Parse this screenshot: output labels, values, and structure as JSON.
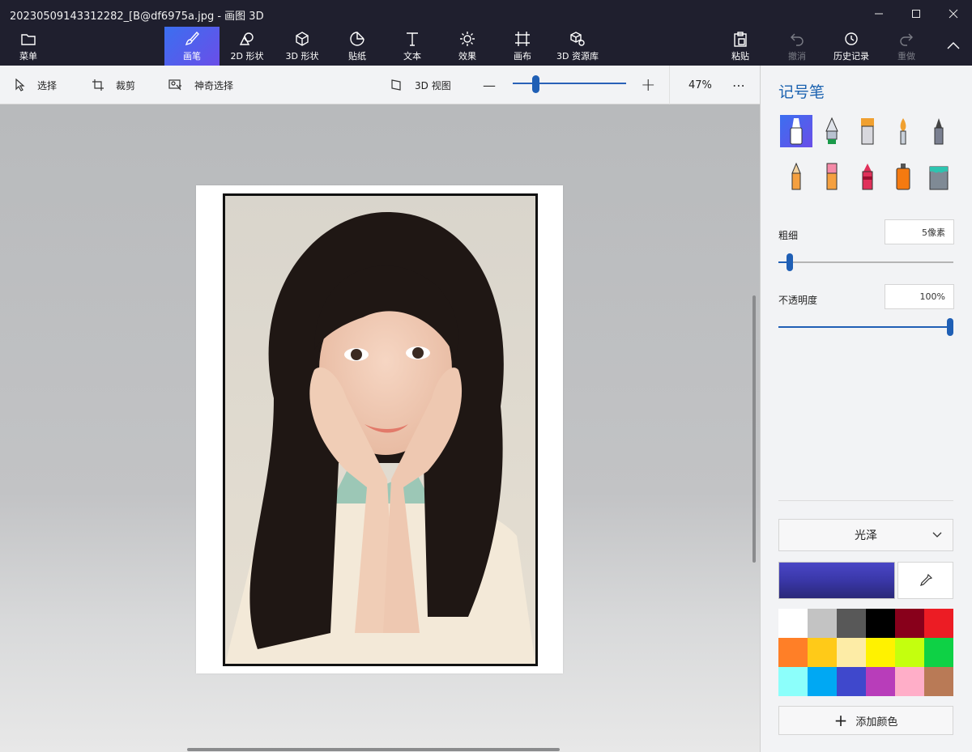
{
  "window": {
    "title": "20230509143312282_[B@df6975a.jpg - 画图 3D"
  },
  "ribbon": {
    "menu": "菜单",
    "tools": [
      {
        "label": "画笔",
        "icon": "brush-icon",
        "active": true
      },
      {
        "label": "2D 形状",
        "icon": "2d-shapes-icon"
      },
      {
        "label": "3D 形状",
        "icon": "3d-shapes-icon"
      },
      {
        "label": "贴纸",
        "icon": "sticker-icon"
      },
      {
        "label": "文本",
        "icon": "text-icon"
      },
      {
        "label": "效果",
        "icon": "effects-icon"
      },
      {
        "label": "画布",
        "icon": "canvas-icon"
      },
      {
        "label": "3D 资源库",
        "icon": "3d-library-icon"
      }
    ],
    "right": [
      {
        "label": "粘贴",
        "icon": "paste-icon",
        "enabled": true
      },
      {
        "label": "撤消",
        "icon": "undo-icon",
        "enabled": false
      },
      {
        "label": "历史记录",
        "icon": "history-icon",
        "enabled": true
      },
      {
        "label": "重做",
        "icon": "redo-icon",
        "enabled": false
      }
    ]
  },
  "toolbar": {
    "select": "选择",
    "crop": "裁剪",
    "magic_select": "神奇选择",
    "view3d": "3D 视图",
    "zoom_minus": "—",
    "zoom_plus": "+",
    "zoom": "47%",
    "zoom_fraction": 0.2,
    "more": "⋯"
  },
  "panel": {
    "title": "记号笔",
    "brushes": [
      "marker-icon",
      "calligraphy-pen-icon",
      "oil-brush-icon",
      "watercolor-icon",
      "pixel-pen-icon",
      "pencil-icon",
      "eraser-icon",
      "crayon-icon",
      "spray-can-icon",
      "fill-bucket-icon"
    ],
    "thickness_label": "粗细",
    "thickness_value": "5像素",
    "thickness_fraction": 0.05,
    "opacity_label": "不透明度",
    "opacity_value": "100%",
    "opacity_fraction": 1.0,
    "finish": "光泽",
    "current_color": "#3a37a8",
    "palette": [
      "#ffffff",
      "#c3c3c3",
      "#585858",
      "#000000",
      "#88001b",
      "#ec1c24",
      "#ff7f27",
      "#ffca18",
      "#fdeca6",
      "#fff200",
      "#c4ff0e",
      "#0ed145",
      "#8cfffb",
      "#00a8f3",
      "#3f48cc",
      "#b83dba",
      "#ffaec8",
      "#b97a56"
    ],
    "add_color": "添加颜色"
  },
  "colors": {
    "accent": "#1b62b0",
    "ribbon_bg": "#1f1f2e"
  }
}
